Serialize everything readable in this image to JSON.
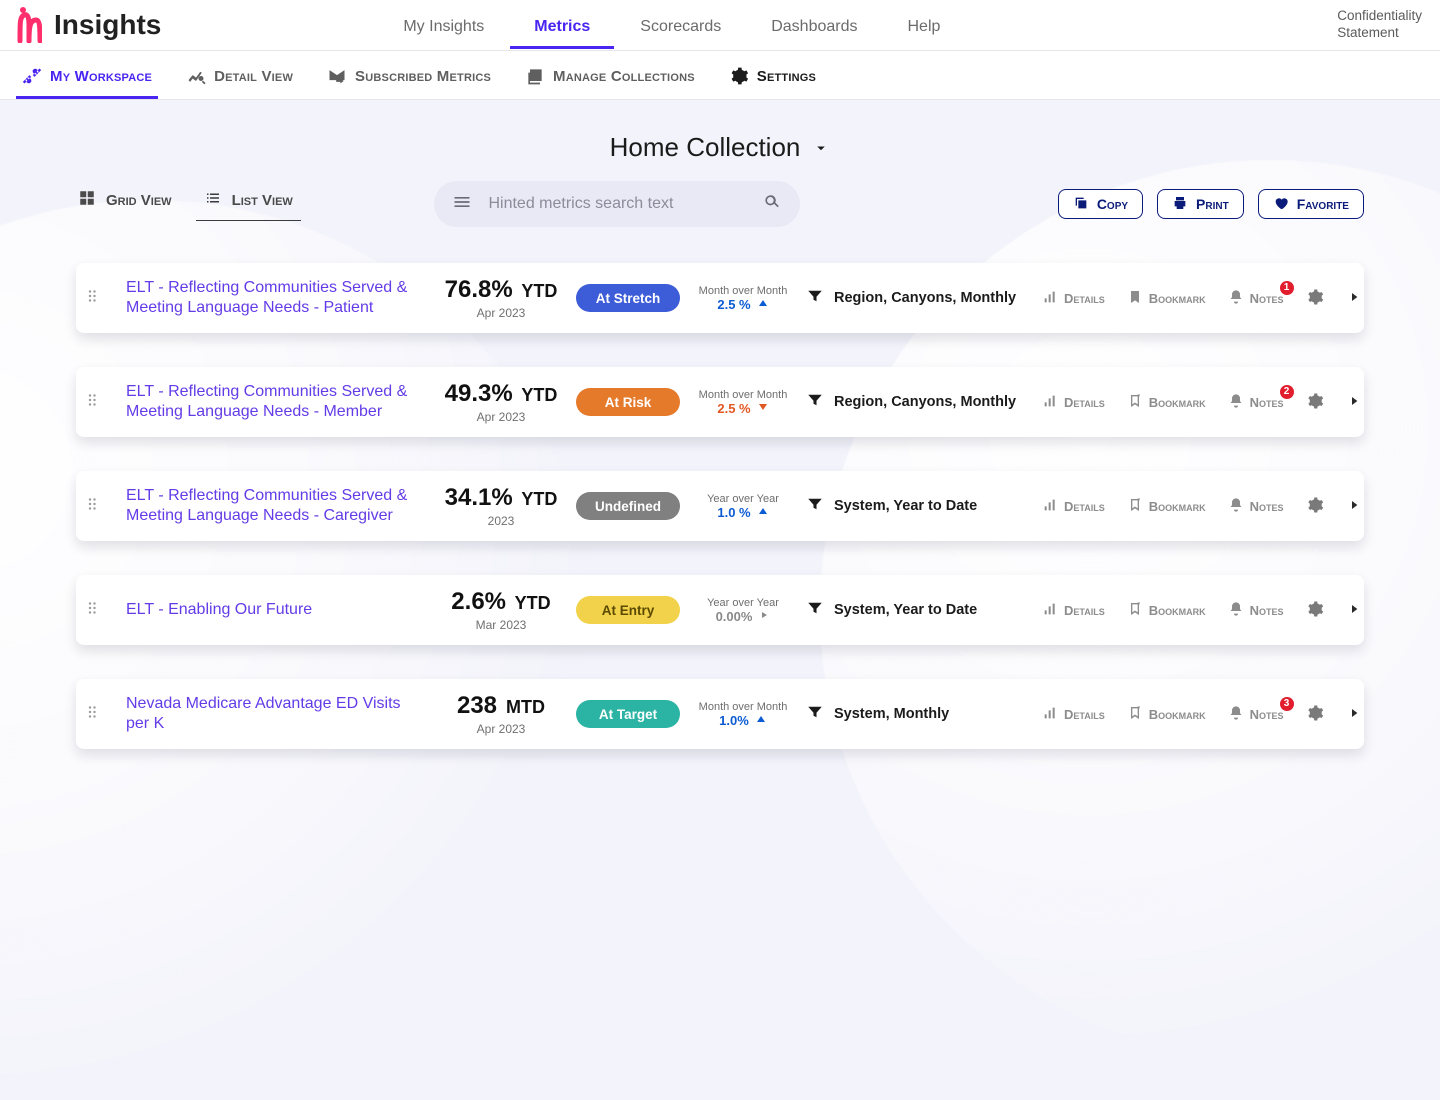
{
  "brand": {
    "title": "Insights"
  },
  "topnav": {
    "my_insights": "My Insights",
    "metrics": "Metrics",
    "scorecards": "Scorecards",
    "dashboards": "Dashboards",
    "help": "Help"
  },
  "top_right": {
    "line1": "Confidentiality",
    "line2": "Statement"
  },
  "subnav": {
    "my_workspace": "My Workspace",
    "detail_view": "Detail View",
    "subscribed": "Subscribed Metrics",
    "manage": "Manage Collections",
    "settings": "Settings"
  },
  "collection": {
    "name": "Home Collection"
  },
  "views": {
    "grid": "Grid View",
    "list": "List View"
  },
  "search": {
    "placeholder": "Hinted metrics search text"
  },
  "actions": {
    "copy": "Copy",
    "print": "Print",
    "favorite": "Favorite"
  },
  "meta_labels": {
    "details": "Details",
    "bookmark": "Bookmark",
    "notes": "Notes"
  },
  "status_colors": {
    "At Stretch": "#3D5CD8",
    "At Risk": "#E57A2B",
    "Undefined": "#808080",
    "At Entry": "#F2D24A",
    "At Target": "#2BB3A3"
  },
  "rows": [
    {
      "title": "ELT - Reflecting Communities Served & Meeting Language Needs - Patient",
      "value": "76.8%",
      "suffix": "YTD",
      "date": "Apr 2023",
      "status": "At Stretch",
      "trend": {
        "label": "Month over Month",
        "value": "2.5 %",
        "dir": "up"
      },
      "filter": "Region, Canyons, Monthly",
      "bookmarked": true,
      "notes": 1
    },
    {
      "title": "ELT - Reflecting Communities Served & Meeting Language Needs - Member",
      "value": "49.3%",
      "suffix": "YTD",
      "date": "Apr 2023",
      "status": "At Risk",
      "trend": {
        "label": "Month over Month",
        "value": "2.5 %",
        "dir": "down"
      },
      "filter": "Region, Canyons, Monthly",
      "bookmarked": false,
      "notes": 2
    },
    {
      "title": "ELT - Reflecting Communities Served & Meeting Language Needs - Caregiver",
      "value": "34.1%",
      "suffix": "YTD",
      "date": "2023",
      "status": "Undefined",
      "trend": {
        "label": "Year over Year",
        "value": "1.0 %",
        "dir": "up"
      },
      "filter": "System, Year to Date",
      "bookmarked": false,
      "notes": 0
    },
    {
      "title": "ELT - Enabling Our Future",
      "value": "2.6%",
      "suffix": "YTD",
      "date": "Mar 2023",
      "status": "At Entry",
      "trend": {
        "label": "Year over Year",
        "value": "0.00%",
        "dir": "flat"
      },
      "filter": "System, Year to Date",
      "bookmarked": false,
      "notes": 0
    },
    {
      "title": "Nevada Medicare Advantage ED Visits per K",
      "value": "238",
      "suffix": "MTD",
      "date": "Apr 2023",
      "status": "At Target",
      "trend": {
        "label": "Month over Month",
        "value": "1.0%",
        "dir": "up"
      },
      "filter": "System, Monthly",
      "bookmarked": false,
      "notes": 3
    }
  ]
}
